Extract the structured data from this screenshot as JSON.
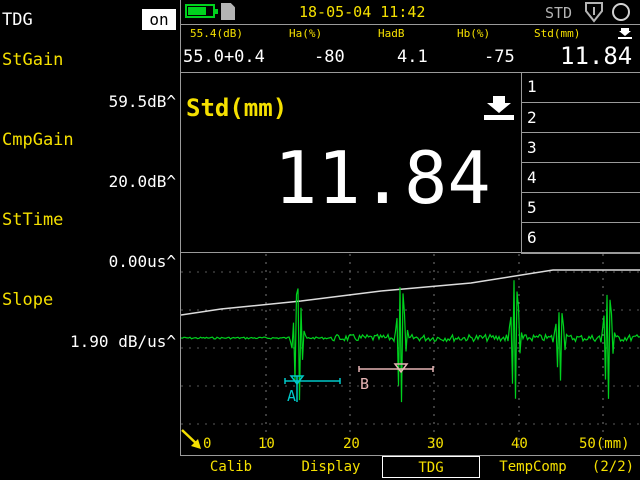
{
  "sidebar": {
    "mode_label": "TDG",
    "mode_toggle": "on",
    "params": [
      {
        "name": "StGain",
        "value": "59.5dB^"
      },
      {
        "name": "CmpGain",
        "value": "20.0dB^"
      },
      {
        "name": "StTime",
        "value": "0.00us^"
      },
      {
        "name": "Slope",
        "value": "1.90 dB/us^"
      }
    ]
  },
  "status": {
    "datetime": "18-05-04 11:42",
    "mode": "STD",
    "battery_level": 0.75
  },
  "readouts": {
    "labels": [
      "55.4(dB)",
      "Ha(%)",
      "HadB",
      "Hb(%)",
      "Std(mm)"
    ],
    "values": [
      "55.0+0.4",
      "-80",
      "4.1",
      "-75",
      "11.84"
    ]
  },
  "main": {
    "big_label": "Std(mm)",
    "big_value": "11.84"
  },
  "gate_slots": [
    "1",
    "2",
    "3",
    "4",
    "5",
    "6"
  ],
  "plot": {
    "x_ticks": [
      "0",
      "10",
      "20",
      "30",
      "40",
      "50(mm)"
    ],
    "gate_a_label": "A",
    "gate_b_label": "B",
    "colors": {
      "waveform": "#00d21e",
      "gate_a": "#00c8c8",
      "gate_b": "#e6b4b4",
      "tdg_curve": "#dcdcdc"
    }
  },
  "menu": {
    "items": [
      "Calib",
      "Display",
      "TDG",
      "TempComp"
    ],
    "active": "TDG",
    "page": "(2/2)"
  }
}
